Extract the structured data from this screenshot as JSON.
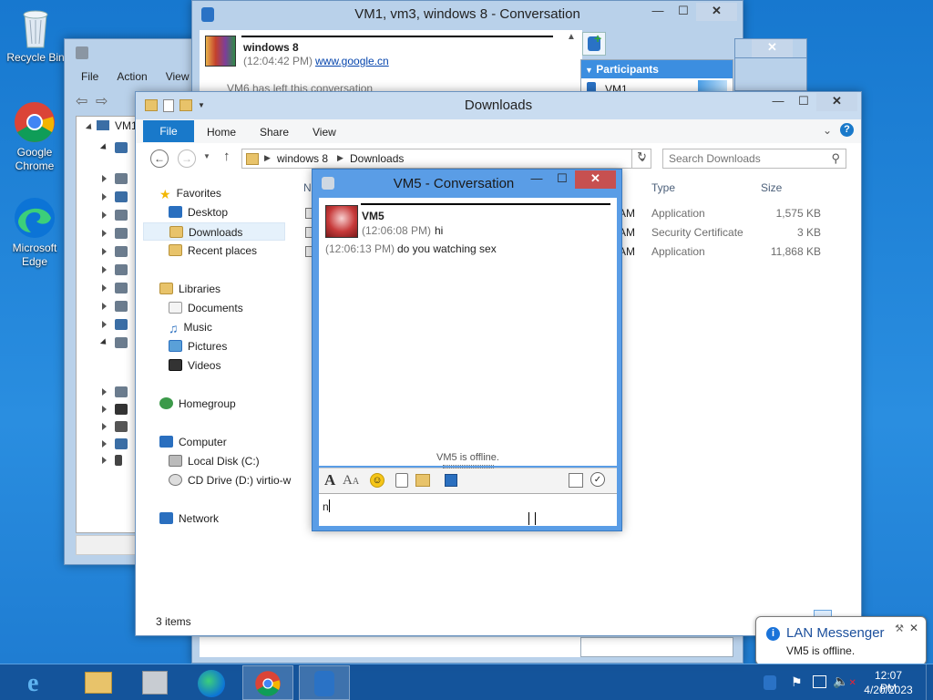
{
  "desktop": {
    "icons": [
      {
        "label": "Recycle Bin"
      },
      {
        "label": "Google Chrome"
      },
      {
        "label": "Microsoft Edge"
      }
    ]
  },
  "device_manager": {
    "menu": [
      "File",
      "Action",
      "View"
    ],
    "root_label": "VM1"
  },
  "main_conversation": {
    "title": "VM1, vm3, windows 8 - Conversation",
    "sender": "windows 8",
    "time": "(12:04:42 PM)",
    "link": "www.google.cn",
    "system_msg": "VM6 has left this conversation",
    "participants_header": "Participants",
    "participant": "VM1"
  },
  "explorer": {
    "title": "Downloads",
    "tabs": {
      "file": "File",
      "home": "Home",
      "share": "Share",
      "view": "View"
    },
    "breadcrumb": [
      "windows 8",
      "Downloads"
    ],
    "search_placeholder": "Search Downloads",
    "nav": {
      "favorites": "Favorites",
      "desktop": "Desktop",
      "downloads": "Downloads",
      "recent": "Recent places",
      "libraries": "Libraries",
      "documents": "Documents",
      "music": "Music",
      "pictures": "Pictures",
      "videos": "Videos",
      "homegroup": "Homegroup",
      "computer": "Computer",
      "local_disk": "Local Disk (C:)",
      "cd_drive": "CD Drive (D:) virtio-w",
      "network": "Network"
    },
    "columns": {
      "name": "N",
      "type": "Type",
      "size": "Size"
    },
    "files": [
      {
        "time": "AM",
        "type": "Application",
        "size": "1,575 KB"
      },
      {
        "time": "AM",
        "type": "Security Certificate",
        "size": "3 KB"
      },
      {
        "time": "AM",
        "type": "Application",
        "size": "11,868 KB"
      }
    ],
    "status": "3 items"
  },
  "vm5_conversation": {
    "title": "VM5 - Conversation",
    "sender": "VM5",
    "messages": [
      {
        "time": "(12:06:08 PM)",
        "text": "hi"
      },
      {
        "time": "(12:06:13 PM)",
        "text": "do you watching sex"
      }
    ],
    "status": "VM5 is offline.",
    "input_value": "n"
  },
  "notification": {
    "title": "LAN Messenger",
    "body": "VM5 is offline."
  },
  "clock": {
    "time": "12:07 PM",
    "date": "4/20/2023"
  },
  "colors": {
    "accent": "#1979ca",
    "close_red": "#c75050",
    "link": "#0645ad"
  }
}
